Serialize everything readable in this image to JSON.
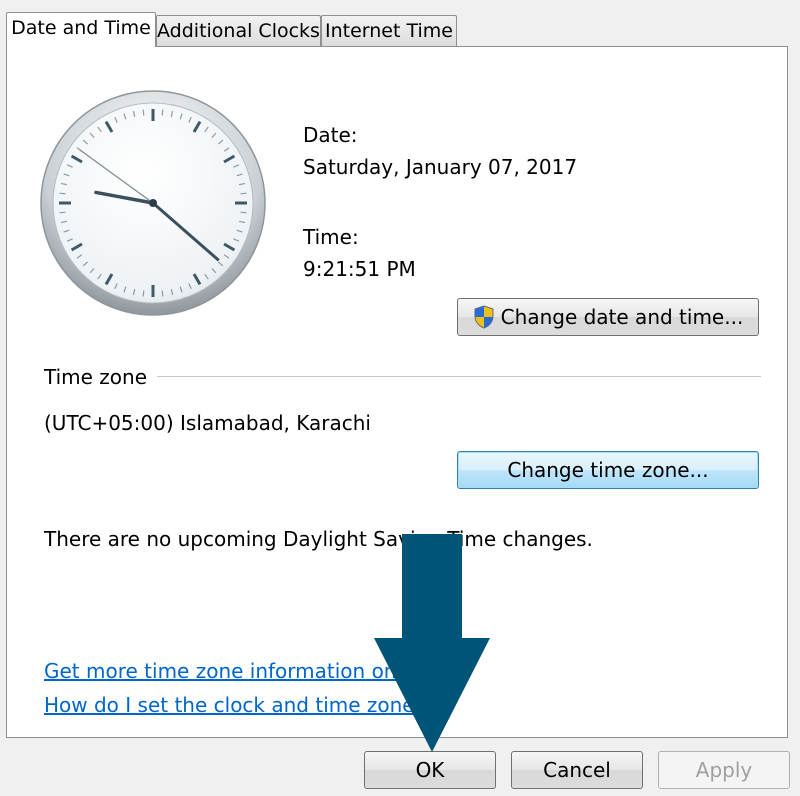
{
  "tabs": [
    {
      "label": "Date and Time",
      "active": true
    },
    {
      "label": "Additional Clocks",
      "active": false
    },
    {
      "label": "Internet Time",
      "active": false
    }
  ],
  "clock": {
    "hours": 9,
    "minutes": 21,
    "seconds": 51
  },
  "date": {
    "label": "Date:",
    "value": "Saturday, January 07, 2017"
  },
  "time": {
    "label": "Time:",
    "value": "9:21:51 PM"
  },
  "change_datetime_button": {
    "label": "Change date and time...",
    "icon": "uac-shield-icon"
  },
  "timezone": {
    "heading": "Time zone",
    "value": "(UTC+05:00) Islamabad, Karachi",
    "change_button": "Change time zone...",
    "dst_message": "There are no upcoming Daylight Saving Time changes."
  },
  "links": {
    "more_info": "Get more time zone information online",
    "how_to": "How do I set the clock and time zone?"
  },
  "footer": {
    "ok": "OK",
    "cancel": "Cancel",
    "apply": "Apply"
  },
  "colors": {
    "arrow": "#005478",
    "link": "#0066cc",
    "focus_border": "#3c7fb1"
  }
}
